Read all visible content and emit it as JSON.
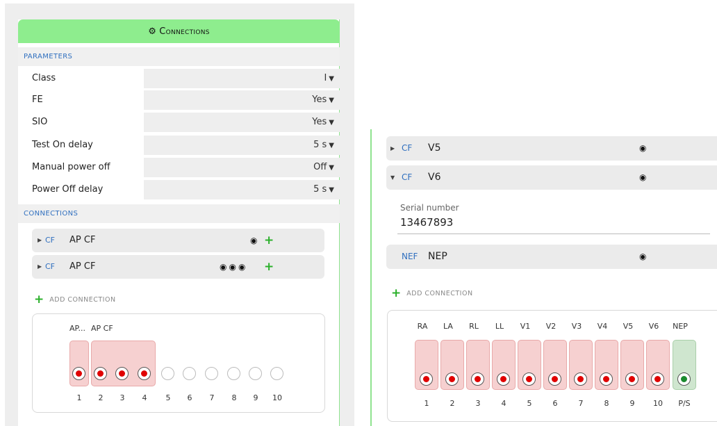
{
  "left": {
    "header_title": "Connections",
    "parameters_label": "PARAMETERS",
    "parameters": [
      {
        "label": "Class",
        "value": "I"
      },
      {
        "label": "FE",
        "value": "Yes"
      },
      {
        "label": "SIO",
        "value": "Yes"
      },
      {
        "label": "Test On delay",
        "value": "5 s"
      },
      {
        "label": "Manual power off",
        "value": "Off"
      },
      {
        "label": "Power Off delay",
        "value": "5 s"
      }
    ],
    "connections_label": "CONNECTIONS",
    "connections": [
      {
        "type": "CF",
        "name": "AP CF",
        "dots": "◉"
      },
      {
        "type": "CF",
        "name": "AP CF",
        "dots": "◉◉◉"
      }
    ],
    "add_connection": "ADD CONNECTION",
    "electrode_groups": [
      "AP...",
      "AP CF"
    ],
    "pin_numbers": [
      "1",
      "2",
      "3",
      "4",
      "5",
      "6",
      "7",
      "8",
      "9",
      "10"
    ]
  },
  "right": {
    "connections": [
      {
        "type": "CF",
        "name": "V5",
        "dot": "◉",
        "expanded": false
      },
      {
        "type": "CF",
        "name": "V6",
        "dot": "◉",
        "expanded": true
      }
    ],
    "serial_label": "Serial number",
    "serial_value": "13467893",
    "nep": {
      "type": "NEF",
      "name": "NEP",
      "dot": "◉"
    },
    "add_connection": "ADD CONNECTION",
    "electrodes": [
      "RA",
      "LA",
      "RL",
      "LL",
      "V1",
      "V2",
      "V3",
      "V4",
      "V5",
      "V6",
      "NEP"
    ],
    "pin_numbers": [
      "1",
      "2",
      "3",
      "4",
      "5",
      "6",
      "7",
      "8",
      "9",
      "10",
      "P/S"
    ]
  },
  "colors": {
    "header_green": "#8eed8e",
    "link_blue": "#2f6fbf",
    "pin_red": "#e00000",
    "pin_green": "#1a8a2e",
    "plus_green": "#2bb02b"
  }
}
